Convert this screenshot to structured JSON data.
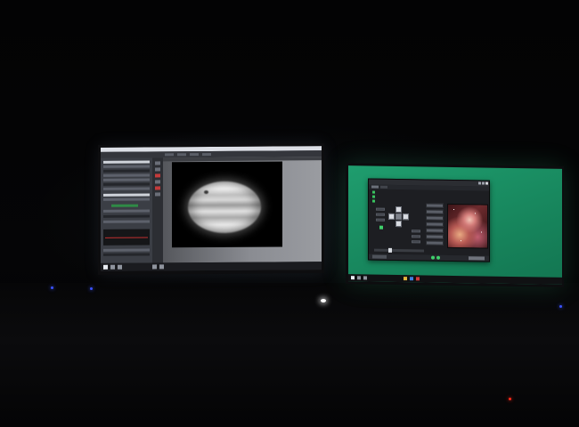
{
  "scene": {
    "description_colors": {
      "room_bg": "#020203",
      "right_desktop": "#1f9d6e",
      "left_app_bg": "#2a2c31"
    }
  },
  "left_monitor": {
    "icons": [
      "windows-start-icon",
      "search-icon",
      "task-view-icon",
      "explorer-icon",
      "app-icon"
    ]
  },
  "right_monitor": {
    "icons": [
      "windows-start-icon",
      "search-icon",
      "task-view-icon",
      "explorer-icon",
      "browser-icon",
      "store-icon"
    ]
  }
}
